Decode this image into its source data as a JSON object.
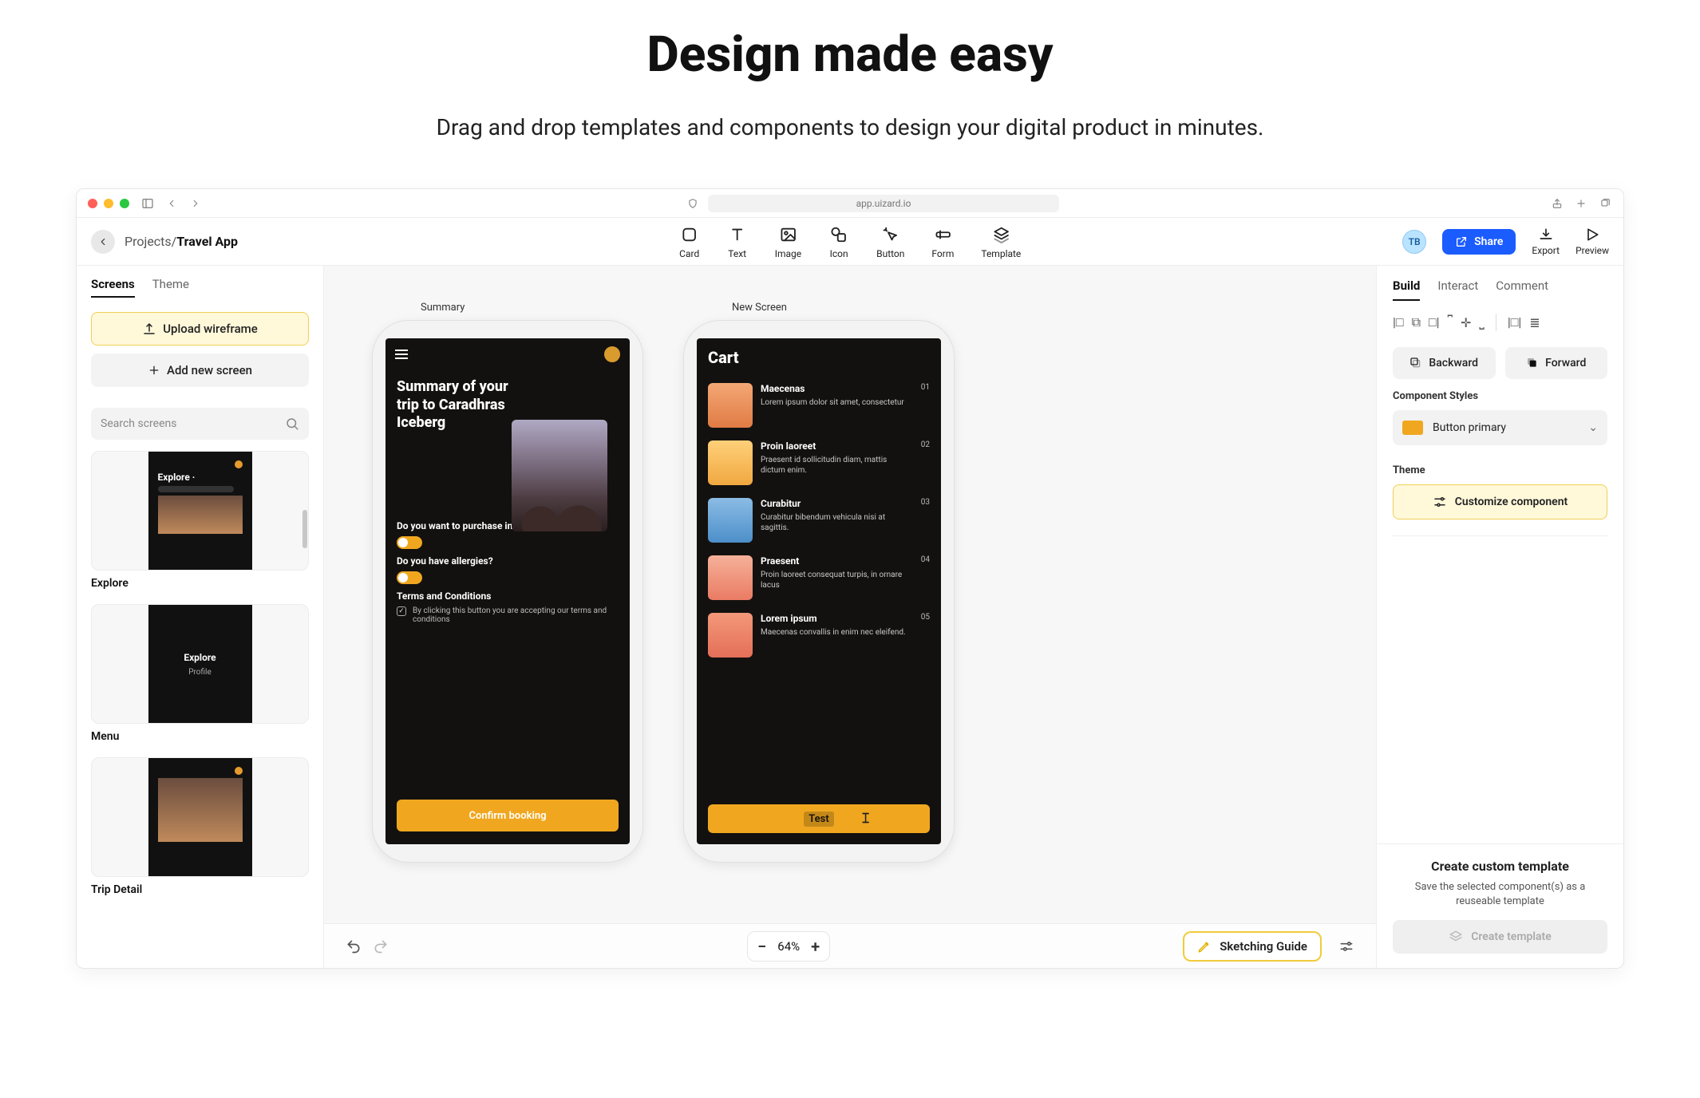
{
  "hero": {
    "title": "Design made easy",
    "subtitle": "Drag and drop templates and components to design your digital product in minutes."
  },
  "browser": {
    "url": "app.uizard.io"
  },
  "breadcrumb": {
    "root": "Projects",
    "separator": "/",
    "current": "Travel App"
  },
  "tools": {
    "card": "Card",
    "text": "Text",
    "image": "Image",
    "icon": "Icon",
    "button": "Button",
    "form": "Form",
    "template": "Template"
  },
  "topright": {
    "avatar_initials": "TB",
    "share": "Share",
    "export": "Export",
    "preview": "Preview"
  },
  "left": {
    "tabs": {
      "screens": "Screens",
      "theme": "Theme"
    },
    "upload": "Upload wireframe",
    "add": "Add new screen",
    "search_placeholder": "Search screens",
    "screens": [
      {
        "label": "Explore",
        "thumb_title": "Explore ·",
        "thumb_sub": ""
      },
      {
        "label": "Menu",
        "thumb_title": "Explore",
        "thumb_sub": "Profile"
      },
      {
        "label": "Trip Detail",
        "thumb_title": "",
        "thumb_sub": ""
      }
    ]
  },
  "canvas": {
    "phones": {
      "summary": {
        "label": "Summary",
        "title": "Summary of your trip to Caradhras Iceberg",
        "q1": "Do you want to purchase in-flight meals?",
        "q2": "Do you have allergies?",
        "terms_h": "Terms and Conditions",
        "terms_t": "By clicking this button you are accepting our terms and conditions",
        "cta": "Confirm booking"
      },
      "cart": {
        "label": "New Screen",
        "title": "Cart",
        "items": [
          {
            "h": "Maecenas",
            "s": "Lorem ipsum dolor sit amet, consectetur",
            "n": "01"
          },
          {
            "h": "Proin laoreet",
            "s": "Praesent id sollicitudin diam, mattis dictum enim.",
            "n": "02"
          },
          {
            "h": "Curabitur",
            "s": "Curabitur bibendum vehicula nisi at sagittis.",
            "n": "03"
          },
          {
            "h": "Praesent",
            "s": "Proin laoreet consequat turpis, in ornare lacus",
            "n": "04"
          },
          {
            "h": "Lorem ipsum",
            "s": "Maecenas convallis in enim nec eleifend.",
            "n": "05"
          }
        ],
        "cta": "Test"
      }
    },
    "footer": {
      "zoom": "64%",
      "sketching_guide": "Sketching Guide"
    }
  },
  "right": {
    "tabs": {
      "build": "Build",
      "interact": "Interact",
      "comment": "Comment"
    },
    "backward": "Backward",
    "forward": "Forward",
    "component_styles_h": "Component Styles",
    "style_name": "Button primary",
    "theme_h": "Theme",
    "customize": "Customize component",
    "template": {
      "h": "Create custom template",
      "s": "Save the selected component(s) as a reuseable template",
      "btn": "Create template"
    }
  }
}
